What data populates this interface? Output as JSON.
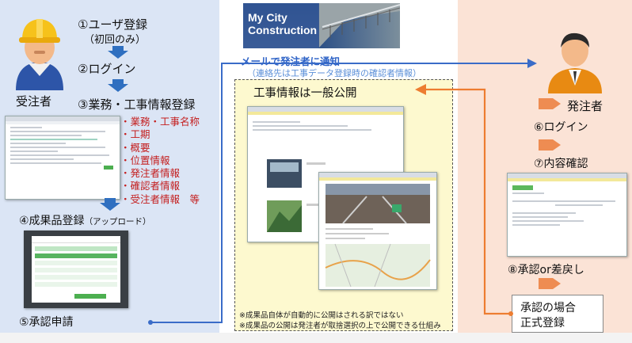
{
  "banner": {
    "line1": "My City",
    "line2": "Construction"
  },
  "contractor": {
    "role_label": "受注者",
    "step1_main": "①ユーザ登録",
    "step1_sub": "（初回のみ）",
    "step2": "②ログイン",
    "step3": "③業務・工事情報登録",
    "registration_items": [
      "・業務・工事名称",
      "・工期",
      "・概要",
      "・位置情報",
      "・発注者情報",
      "・確認者情報",
      "・受注者情報　等"
    ],
    "step4_main": "④成果品登録",
    "step4_sub": "（アップロード）",
    "step5": "⑤承認申請"
  },
  "notify": {
    "title": "メールで発注者に通知",
    "subtitle": "（連絡先は工事データ登録時の確認者情報）"
  },
  "public": {
    "title": "工事情報は一般公開",
    "note1": "※成果品自体が自動的に公開はされる訳ではない",
    "note2": "※成果品の公開は発注者が取捨選択の上で公開できる仕組み"
  },
  "orderer": {
    "role_label": "発注者",
    "step6": "⑥ログイン",
    "step7": "⑦内容確認",
    "step8": "⑧承認or差戻し",
    "approval_line1": "承認の場合",
    "approval_line2": "正式登録"
  },
  "colors": {
    "left_panel": "#dbe5f5",
    "right_panel": "#fbe3d6",
    "blue_arrow": "#3a6cc8",
    "orange_arrow": "#ed7d31",
    "down_arrow_blue": "#2f6fc0",
    "down_arrow_orange": "#ee8c52"
  }
}
